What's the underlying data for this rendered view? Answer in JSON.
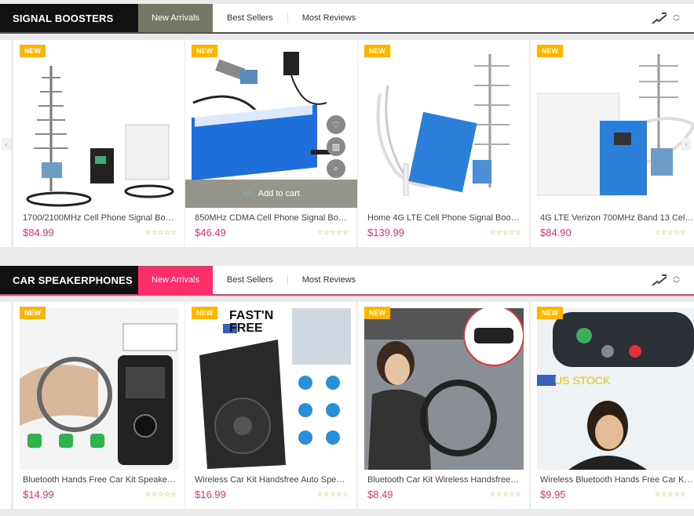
{
  "sections": [
    {
      "title": "SIGNAL BOOSTERS",
      "tabs": [
        "New Arrivals",
        "Best Sellers",
        "Most Reviews"
      ],
      "products": [
        {
          "badge": "NEW",
          "name": "1700/2100MHz Cell Phone Signal Boos...",
          "price": "$84.99",
          "stars": "☆☆☆☆☆"
        },
        {
          "badge": "NEW",
          "name": "850MHz CDMA Cell Phone Signal Boos...",
          "price": "$46.49",
          "stars": "☆☆☆☆☆",
          "add_to_cart": "Add to cart"
        },
        {
          "badge": "NEW",
          "name": "Home 4G LTE Cell Phone Signal Boost...",
          "price": "$139.99",
          "stars": "☆☆☆☆☆"
        },
        {
          "badge": "NEW",
          "name": "4G LTE Verizon 700MHz Band 13 Cell ...",
          "price": "$84.90",
          "stars": "☆☆☆☆☆"
        }
      ]
    },
    {
      "title": "CAR SPEAKERPHONES",
      "tabs": [
        "New Arrivals",
        "Best Sellers",
        "Most Reviews"
      ],
      "products": [
        {
          "badge": "NEW",
          "name": "Bluetooth Hands Free Car Kit Speakerp...",
          "price": "$14.99",
          "stars": "☆☆☆☆☆"
        },
        {
          "badge": "NEW",
          "name": "Wireless Car Kit Handsfree Auto Speak...",
          "price": "$16.99",
          "stars": "☆☆☆☆☆",
          "image_text": "FAST'N FREE"
        },
        {
          "badge": "NEW",
          "name": "Bluetooth Car Kit Wireless Handsfree S...",
          "price": "$8.49",
          "stars": "☆☆☆☆☆"
        },
        {
          "badge": "NEW",
          "name": "Wireless Bluetooth Hands Free Car Kit ...",
          "price": "$9.95",
          "stars": "☆☆☆☆☆",
          "image_text": "US STOCK"
        }
      ]
    }
  ],
  "colors": {
    "accent_pink": "#ff2d6a",
    "price": "#e8336f",
    "badge": "#ffb400"
  }
}
